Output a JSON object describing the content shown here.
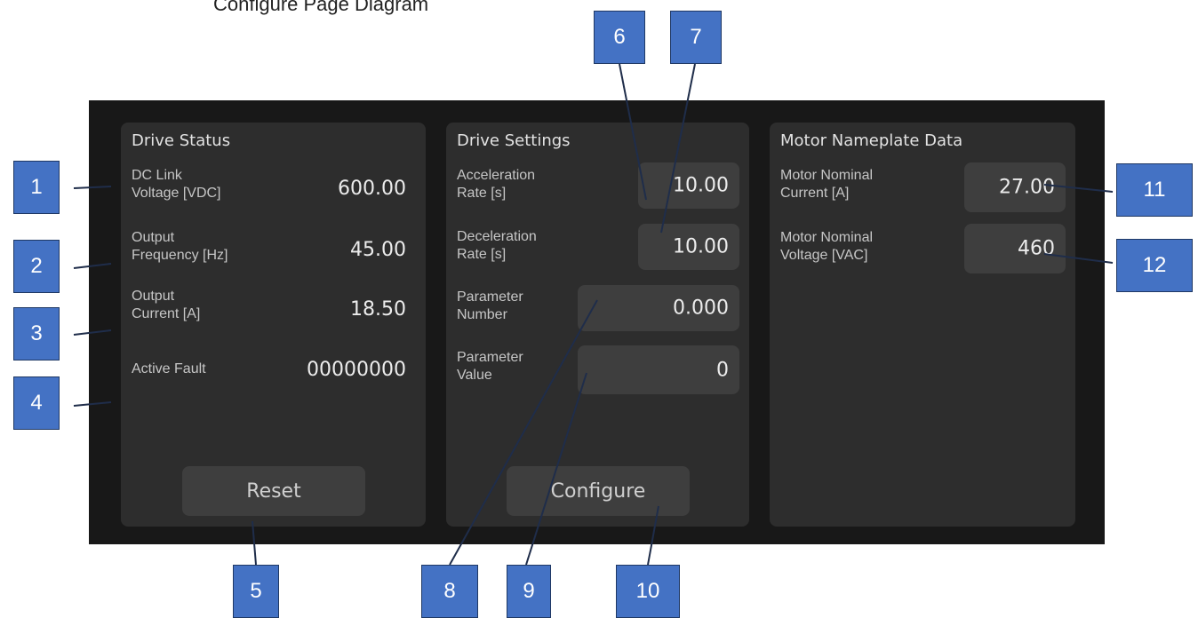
{
  "page_title": "Configure Page Diagram",
  "panels": {
    "status": {
      "title": "Drive Status",
      "dc_link_label_1": "DC Link",
      "dc_link_label_2": "Voltage [VDC]",
      "dc_link_value": "600.00",
      "freq_label_1": "Output",
      "freq_label_2": "Frequency [Hz]",
      "freq_value": "45.00",
      "current_label_1": "Output",
      "current_label_2": "Current [A]",
      "current_value": "18.50",
      "fault_label": "Active Fault",
      "fault_value": "00000000",
      "reset_label": "Reset"
    },
    "settings": {
      "title": "Drive Settings",
      "accel_label_1": "Acceleration",
      "accel_label_2": "Rate [s]",
      "accel_value": "10.00",
      "decel_label_1": "Deceleration",
      "decel_label_2": "Rate [s]",
      "decel_value": "10.00",
      "param_num_label_1": "Parameter",
      "param_num_label_2": "Number",
      "param_num_value": "0.000",
      "param_val_label_1": "Parameter",
      "param_val_label_2": "Value",
      "param_val_value": "0",
      "configure_label": "Configure"
    },
    "nameplate": {
      "title": "Motor Nameplate Data",
      "current_label_1": "Motor Nominal",
      "current_label_2": "Current [A]",
      "current_value": "27.00",
      "voltage_label_1": "Motor Nominal",
      "voltage_label_2": "Voltage [VAC]",
      "voltage_value": "460"
    }
  },
  "callouts": [
    "1",
    "2",
    "3",
    "4",
    "5",
    "6",
    "7",
    "8",
    "9",
    "10",
    "11",
    "12"
  ],
  "colors": {
    "callout_fill": "#4472c4",
    "panel_bg": "#2d2d2d",
    "screen_bg": "#181818"
  }
}
